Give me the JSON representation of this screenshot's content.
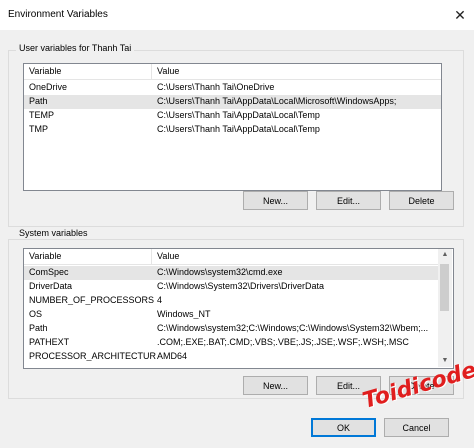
{
  "window": {
    "title": "Environment Variables",
    "close_glyph": "✕"
  },
  "user_vars": {
    "group_label": "User variables for Thanh Tai",
    "columns": {
      "variable": "Variable",
      "value": "Value"
    },
    "rows": [
      {
        "name": "OneDrive",
        "value": "C:\\Users\\Thanh Tai\\OneDrive"
      },
      {
        "name": "Path",
        "value": "C:\\Users\\Thanh Tai\\AppData\\Local\\Microsoft\\WindowsApps;"
      },
      {
        "name": "TEMP",
        "value": "C:\\Users\\Thanh Tai\\AppData\\Local\\Temp"
      },
      {
        "name": "TMP",
        "value": "C:\\Users\\Thanh Tai\\AppData\\Local\\Temp"
      }
    ],
    "selected_row": "Path",
    "buttons": {
      "new": "New...",
      "edit": "Edit...",
      "delete": "Delete"
    }
  },
  "system_vars": {
    "group_label": "System variables",
    "columns": {
      "variable": "Variable",
      "value": "Value"
    },
    "rows": [
      {
        "name": "ComSpec",
        "value": "C:\\Windows\\system32\\cmd.exe"
      },
      {
        "name": "DriverData",
        "value": "C:\\Windows\\System32\\Drivers\\DriverData"
      },
      {
        "name": "NUMBER_OF_PROCESSORS",
        "value": "4"
      },
      {
        "name": "OS",
        "value": "Windows_NT"
      },
      {
        "name": "Path",
        "value": "C:\\Windows\\system32;C:\\Windows;C:\\Windows\\System32\\Wbem;..."
      },
      {
        "name": "PATHEXT",
        "value": ".COM;.EXE;.BAT;.CMD;.VBS;.VBE;.JS;.JSE;.WSF;.WSH;.MSC"
      },
      {
        "name": "PROCESSOR_ARCHITECTURE",
        "value": "AMD64"
      }
    ],
    "selected_row": "ComSpec",
    "buttons": {
      "new": "New...",
      "edit": "Edit...",
      "delete": "Delete"
    },
    "scroll": {
      "up_glyph": "▲",
      "down_glyph": "▼"
    }
  },
  "footer": {
    "ok": "OK",
    "cancel": "Cancel"
  },
  "watermark": {
    "text": "Toidicode.com",
    "color": "#e01e1e"
  }
}
